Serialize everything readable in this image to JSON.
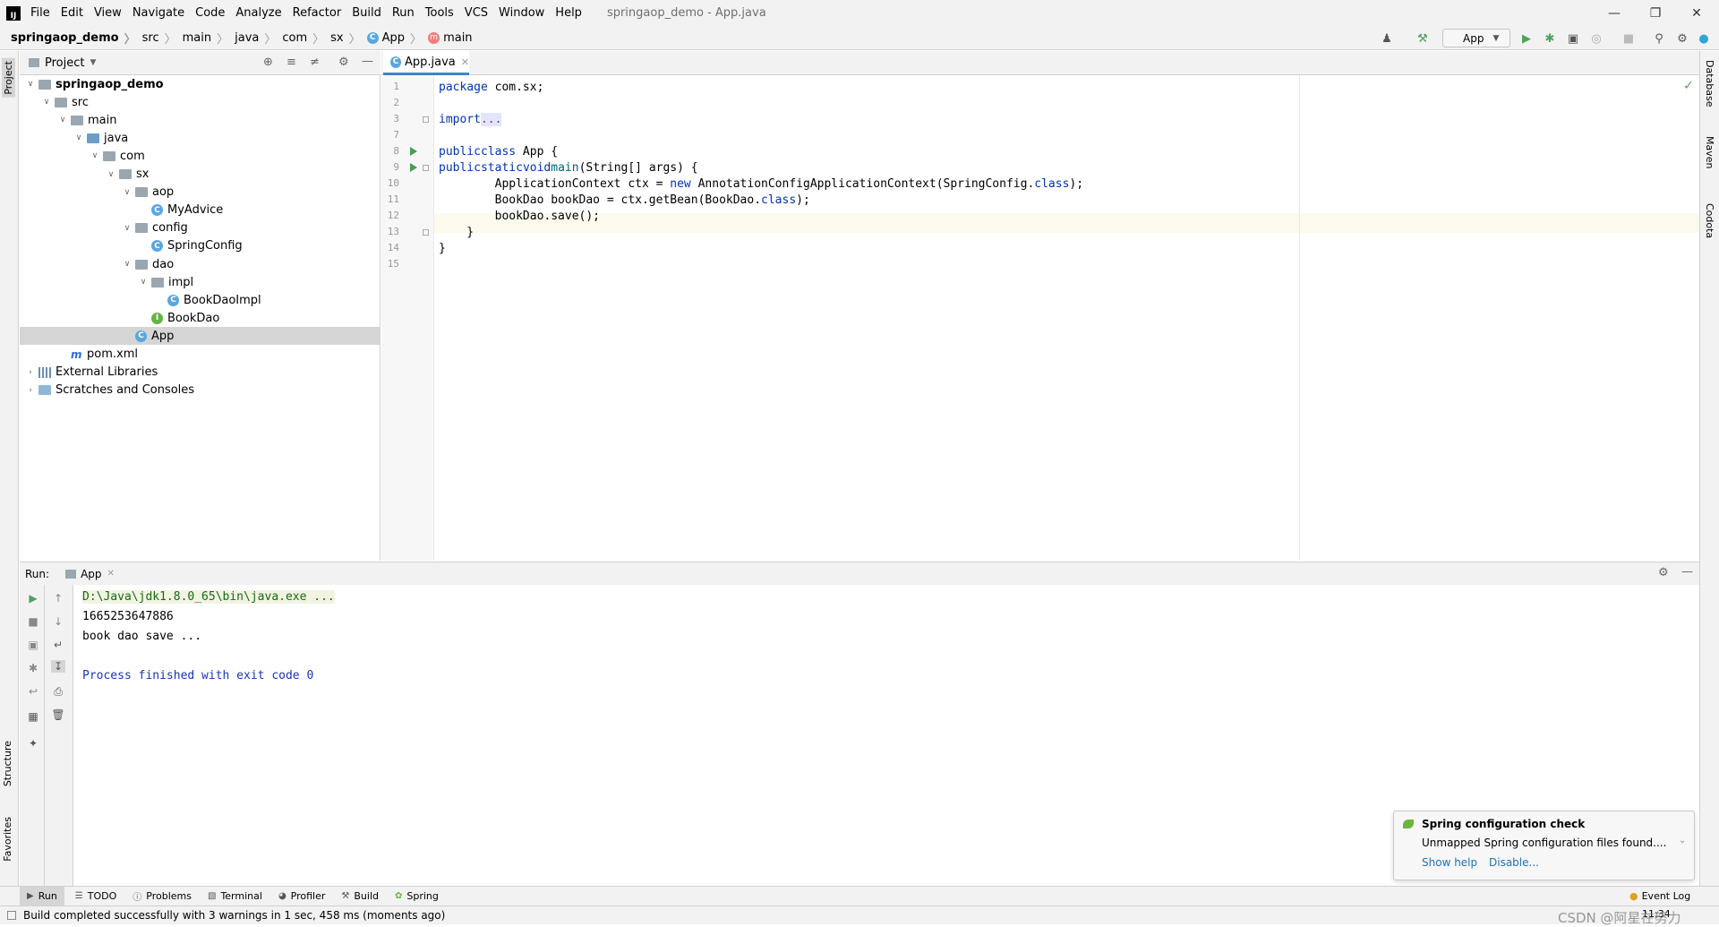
{
  "menubar": {
    "items": [
      "File",
      "Edit",
      "View",
      "Navigate",
      "Code",
      "Analyze",
      "Refactor",
      "Build",
      "Run",
      "Tools",
      "VCS",
      "Window",
      "Help"
    ],
    "window_title": "springaop_demo - App.java"
  },
  "breadcrumb": [
    "springaop_demo",
    "src",
    "main",
    "java",
    "com",
    "sx",
    "App",
    "main"
  ],
  "toolbar": {
    "run_config": "App"
  },
  "left_strip": {
    "project": "Project",
    "structure": "Structure",
    "favorites": "Favorites"
  },
  "right_strip": {
    "database": "Database",
    "maven": "Maven",
    "codota": "Codota"
  },
  "project_panel": {
    "title": "Project"
  },
  "tree": [
    {
      "label": "springaop_demo",
      "indent": 0,
      "arrow": "v",
      "icon": "module-folder-icon",
      "bold": true
    },
    {
      "label": "src",
      "indent": 1,
      "arrow": "v",
      "icon": "folder-icon"
    },
    {
      "label": "main",
      "indent": 2,
      "arrow": "v",
      "icon": "folder-icon"
    },
    {
      "label": "java",
      "indent": 3,
      "arrow": "v",
      "icon": "source-folder-icon"
    },
    {
      "label": "com",
      "indent": 4,
      "arrow": "v",
      "icon": "package-icon"
    },
    {
      "label": "sx",
      "indent": 5,
      "arrow": "v",
      "icon": "package-icon"
    },
    {
      "label": "aop",
      "indent": 6,
      "arrow": "v",
      "icon": "package-icon"
    },
    {
      "label": "MyAdvice",
      "indent": 7,
      "arrow": "",
      "icon": "class-icon"
    },
    {
      "label": "config",
      "indent": 6,
      "arrow": "v",
      "icon": "package-icon"
    },
    {
      "label": "SpringConfig",
      "indent": 7,
      "arrow": "",
      "icon": "class-icon"
    },
    {
      "label": "dao",
      "indent": 6,
      "arrow": "v",
      "icon": "package-icon"
    },
    {
      "label": "impl",
      "indent": 7,
      "arrow": "v",
      "icon": "package-icon"
    },
    {
      "label": "BookDaoImpl",
      "indent": 8,
      "arrow": "",
      "icon": "class-icon"
    },
    {
      "label": "BookDao",
      "indent": 7,
      "arrow": "",
      "icon": "interface-icon"
    },
    {
      "label": "App",
      "indent": 6,
      "arrow": "",
      "icon": "class-icon",
      "selected": true
    },
    {
      "label": "pom.xml",
      "indent": 2,
      "arrow": "",
      "icon": "maven-icon"
    },
    {
      "label": "External Libraries",
      "indent": 0,
      "arrow": ">",
      "icon": "library-icon"
    },
    {
      "label": "Scratches and Consoles",
      "indent": 0,
      "arrow": ">",
      "icon": "scratches-icon"
    }
  ],
  "editor": {
    "tab": "App.java",
    "line_numbers": [
      "1",
      "2",
      "3",
      "7",
      "8",
      "9",
      "10",
      "11",
      "12",
      "13",
      "14",
      "15"
    ],
    "lines": [
      {
        "text": "package com.sx;"
      },
      {
        "text": ""
      },
      {
        "text": "import ..."
      },
      {
        "text": ""
      },
      {
        "text": "public class App {"
      },
      {
        "text": "    public static void main(String[] args) {"
      },
      {
        "text": "        ApplicationContext ctx = new AnnotationConfigApplicationContext(SpringConfig.class);"
      },
      {
        "text": "        BookDao bookDao = ctx.getBean(BookDao.class);"
      },
      {
        "text": "        bookDao.save();"
      },
      {
        "text": "    }"
      },
      {
        "text": "}"
      },
      {
        "text": ""
      }
    ]
  },
  "run_panel": {
    "label": "Run:",
    "tab": "App",
    "console": [
      {
        "text": "D:\\Java\\jdk1.8.0_65\\bin\\java.exe ...",
        "color": "#0e6e0e"
      },
      {
        "text": "1665253647886",
        "color": "#000000"
      },
      {
        "text": "book dao save ...",
        "color": "#000000"
      },
      {
        "text": "",
        "color": "#000000"
      },
      {
        "text": "Process finished with exit code 0",
        "color": "#1a34b8"
      }
    ]
  },
  "notification": {
    "title": "Spring configuration check",
    "body": "Unmapped Spring configuration files found....",
    "action1": "Show help",
    "action2": "Disable..."
  },
  "bottom_tabs": [
    "Run",
    "TODO",
    "Problems",
    "Terminal",
    "Profiler",
    "Build",
    "Spring"
  ],
  "status": {
    "message": "Build completed successfully with 3 warnings in 1 sec, 458 ms (moments ago)",
    "event_log": "Event Log",
    "time": "11:34",
    "watermark": "CSDN @阿星在努力"
  }
}
